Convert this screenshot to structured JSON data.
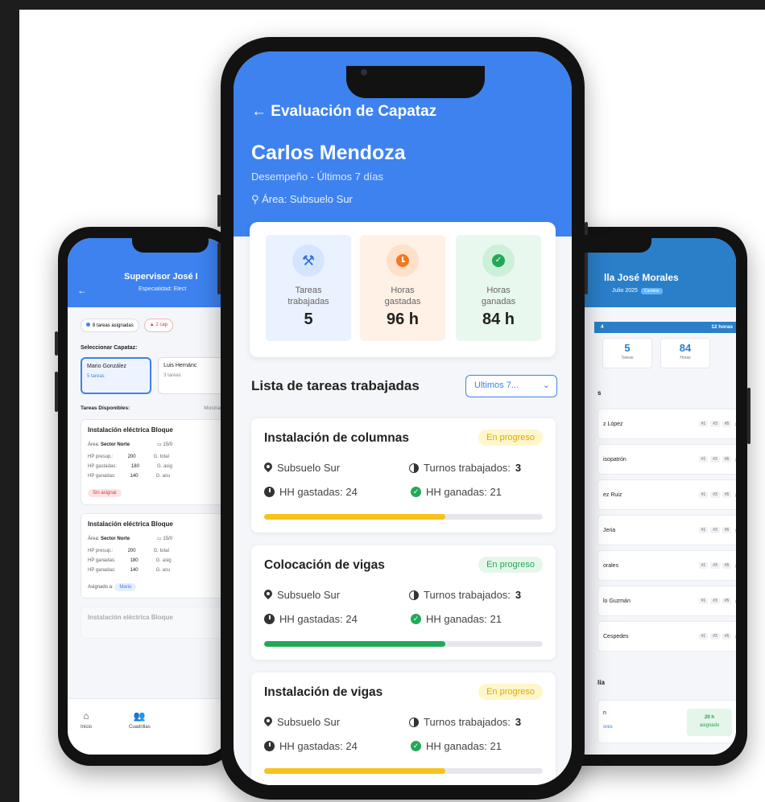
{
  "left_phone": {
    "header_title": "Supervisor José I",
    "header_subtitle": "Especialidad: Elect",
    "chip_assigned": "8 tareas asignadas",
    "chip_alert": "2 cap",
    "select_label": "Seleccionar Capataz:",
    "capataces": [
      {
        "name": "Mario González",
        "tasks": "5 tareas"
      },
      {
        "name": "Luis Hernánc",
        "tasks": "3 tareas"
      }
    ],
    "available_label": "Tareas Disponibles:",
    "showing_label": "Mostrando",
    "cards": [
      {
        "title": "Instalación eléctrica Bloque",
        "area_label": "Área:",
        "area": "Sector Norte",
        "date": "15/0",
        "rows": [
          {
            "k": "HP presup.:",
            "v": "200",
            "r": "G. total"
          },
          {
            "k": "HP gastadas:",
            "v": "180",
            "r": "G. asig"
          },
          {
            "k": "HP ganadas:",
            "v": "140",
            "r": "G. acu"
          }
        ],
        "badge": "Sin asignar"
      },
      {
        "title": "Instalación eléctrica Bloque",
        "area_label": "Área:",
        "area": "Sector Norte",
        "date": "15/0",
        "rows": [
          {
            "k": "HP presup.:",
            "v": "200",
            "r": "G. total"
          },
          {
            "k": "HP ganadas:",
            "v": "180",
            "r": "G. asig"
          },
          {
            "k": "HP ganadas:",
            "v": "140",
            "r": "G. acu"
          }
        ],
        "assigned_label": "Asignado a:",
        "badge": "Mario"
      }
    ],
    "faded_title": "Instalación eléctrica Bloque",
    "nav": [
      {
        "label": "Inicio",
        "icon": "home-icon"
      },
      {
        "label": "Cuadrillas",
        "icon": "users-icon"
      }
    ]
  },
  "center_phone": {
    "back_title": "← Evaluación de Capataz",
    "name": "Carlos Mendoza",
    "performance": "Desempeño - Últimos 7 días",
    "area": "Área: Subsuelo Sur",
    "metrics": [
      {
        "label_1": "Tareas",
        "label_2": "trabajadas",
        "value": "5",
        "icon": "hammer-icon"
      },
      {
        "label_1": "Horas",
        "label_2": "gastadas",
        "value": "96 h",
        "icon": "clock-icon"
      },
      {
        "label_1": "Horas",
        "label_2": "ganadas",
        "value": "84 h",
        "icon": "check-circle-icon"
      }
    ],
    "list_title": "Lista de tareas trabajadas",
    "filter": "Ultimos 7...",
    "tasks": [
      {
        "title": "Instalación de columnas",
        "status": "En progreso",
        "status_color": "yellow",
        "location": "Subsuelo Sur",
        "shifts_label": "Turnos trabajados:",
        "shifts": "3",
        "hh_spent": "HH gastadas: 24",
        "hh_earned": "HH ganadas: 21",
        "progress": 0.65,
        "bar_color": "#f7c21a"
      },
      {
        "title": "Colocación de vigas",
        "status": "En progreso",
        "status_color": "green",
        "location": "Subsuelo Sur",
        "shifts_label": "Turnos trabajados:",
        "shifts": "3",
        "hh_spent": "HH gastadas: 24",
        "hh_earned": "HH ganadas: 21",
        "progress": 0.65,
        "bar_color": "#22a957"
      },
      {
        "title": "Instalación de vigas",
        "status": "En progreso",
        "status_color": "yellow",
        "location": "Subsuelo Sur",
        "shifts_label": "Turnos trabajados:",
        "shifts": "3",
        "hh_spent": "HH gastadas: 24",
        "hh_earned": "HH ganadas: 21",
        "progress": 0.65,
        "bar_color": "#f7c21a"
      }
    ]
  },
  "right_phone": {
    "header_title": "lla José Morales",
    "header_subtitle": "Julio 2025",
    "header_tag": "Cambiar",
    "bar_left": "4",
    "bar_right": "12 horas",
    "stats": [
      {
        "value": "5",
        "label": "Tareas"
      },
      {
        "value": "84",
        "label": "Horas"
      }
    ],
    "section": "s",
    "workers": [
      {
        "name": "z López",
        "tags": [
          "#1",
          "#3",
          "#5"
        ]
      },
      {
        "name": "isopatrón",
        "tags": [
          "#1",
          "#3",
          "#5"
        ]
      },
      {
        "name": "ez Ruiz",
        "tags": [
          "#1",
          "#3",
          "#5"
        ]
      },
      {
        "name": "Jeria",
        "tags": [
          "#1",
          "#3",
          "#5"
        ]
      },
      {
        "name": "orales",
        "tags": [
          "#1",
          "#3",
          "#5"
        ]
      },
      {
        "name": "lo Guzmán",
        "tags": [
          "#1",
          "#3",
          "#5"
        ]
      },
      {
        "name": "Cespedes",
        "tags": [
          "#1",
          "#3",
          "#5"
        ]
      }
    ],
    "bottom_section": "lía",
    "bottom_card_a": "n",
    "bottom_card_b": "ores",
    "bottom_pill_a": "20 h",
    "bottom_pill_b": "asignado"
  }
}
